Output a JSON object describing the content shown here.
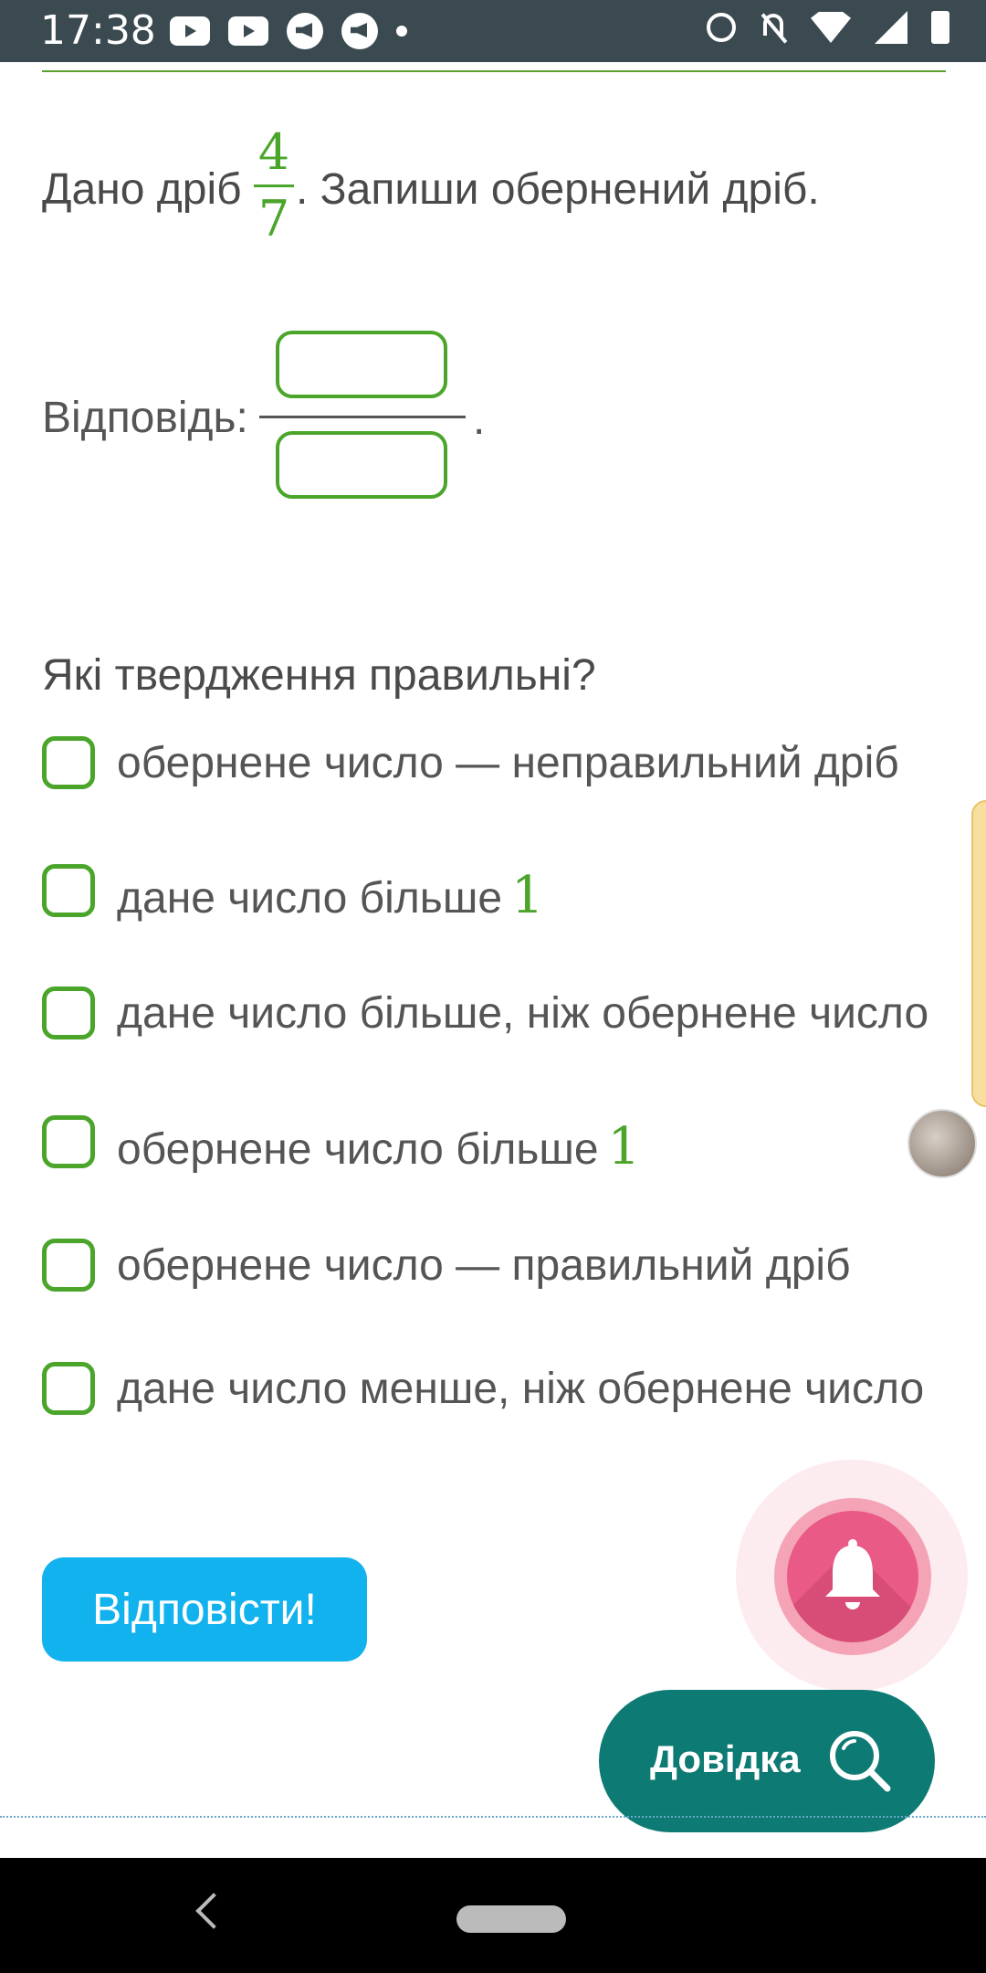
{
  "status_bar": {
    "time": "17:38",
    "left_icons": [
      "youtube-icon",
      "youtube-icon",
      "megaphone-icon",
      "megaphone-icon",
      "dot-icon"
    ],
    "right_icons": [
      "alarm-icon",
      "bell-off-icon",
      "wifi-icon",
      "signal-icon",
      "battery-icon"
    ]
  },
  "question": {
    "prefix": "Дано дріб",
    "numerator": "4",
    "denominator": "7",
    "suffix": ". Запиши обернений дріб."
  },
  "answer": {
    "label": "Відповідь:",
    "numerator_value": "",
    "denominator_value": "",
    "period": "."
  },
  "statements": {
    "title": "Які твердження правильні?",
    "options": [
      {
        "label": "обернене число — неправильний дріб",
        "math": ""
      },
      {
        "label": "дане число більше",
        "math": "1"
      },
      {
        "label": "дане число більше, ніж обернене число",
        "math": ""
      },
      {
        "label": "обернене число більше",
        "math": "1"
      },
      {
        "label": "обернене число — правильний дріб",
        "math": ""
      },
      {
        "label": "дане число менше, ніж обернене число",
        "math": ""
      }
    ]
  },
  "submit_label": "Відповісти!",
  "help_label": "Довідка",
  "colors": {
    "accent_green": "#4aa52a",
    "submit_blue": "#12b2ee",
    "help_teal": "#0e7a74",
    "bell_pink": "#e95a86",
    "status_bar": "#3b4a50"
  }
}
